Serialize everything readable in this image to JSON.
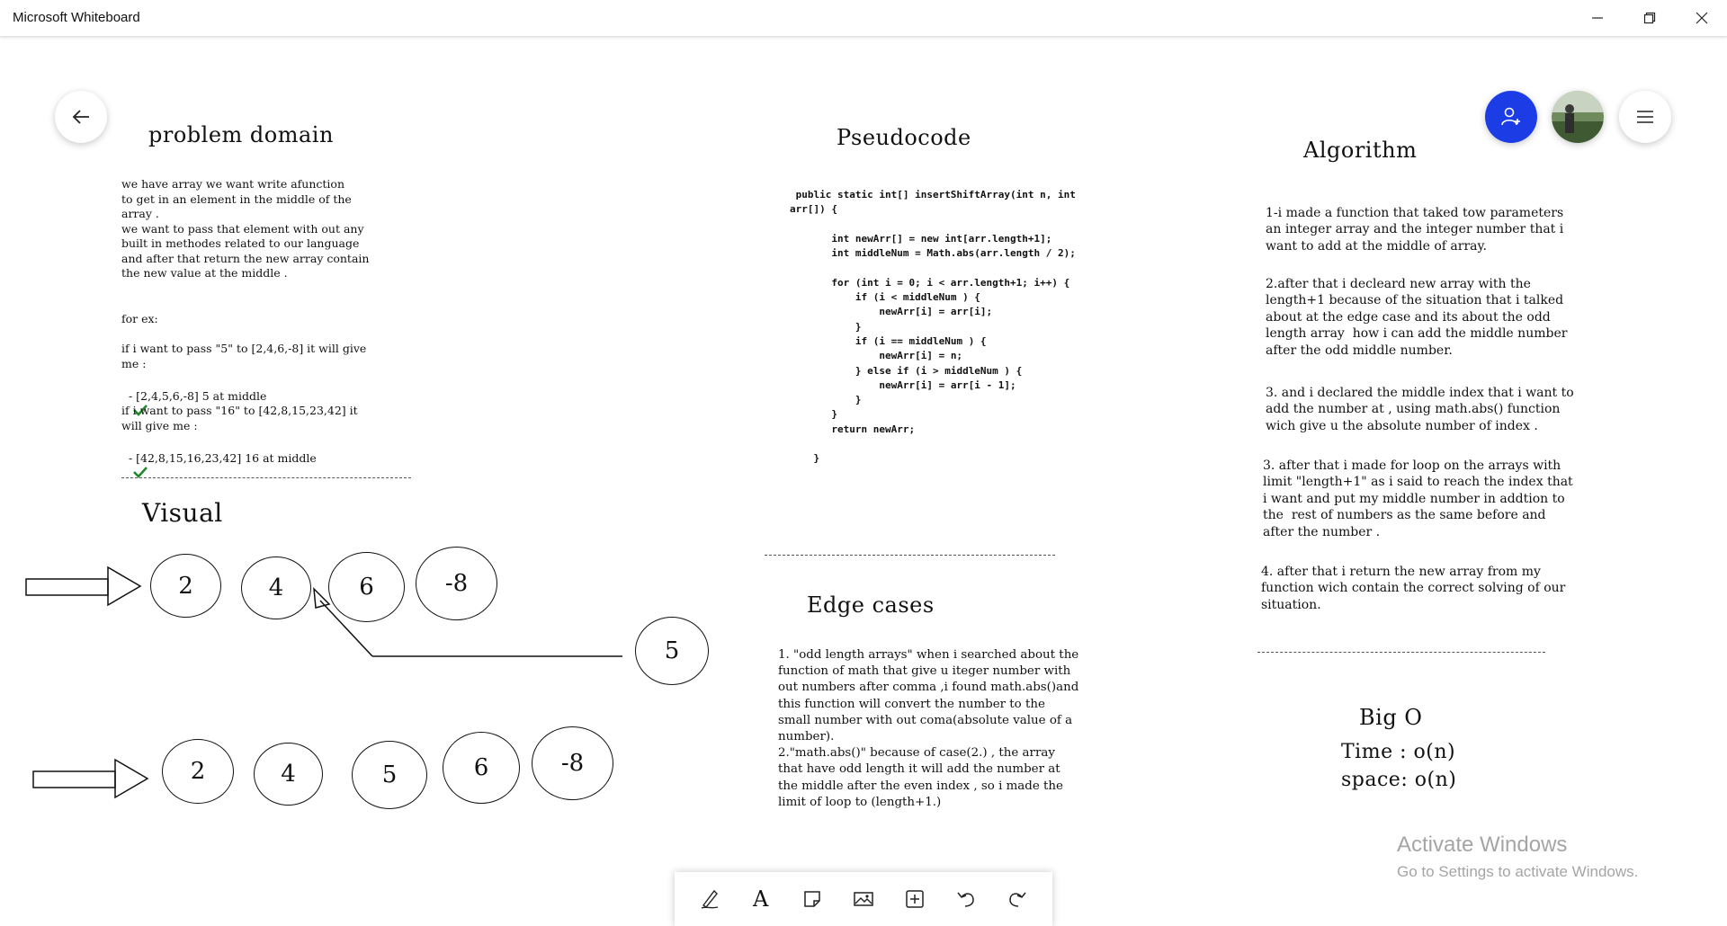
{
  "window": {
    "title": "Microsoft Whiteboard",
    "controls": [
      "minimize-icon",
      "restore-icon",
      "close-icon"
    ]
  },
  "top_controls": {
    "back": "arrow-left-icon",
    "invite": "add-person-icon",
    "avatar": "user-avatar",
    "menu": "hamburger-menu-icon"
  },
  "colors": {
    "invite_blue": "#1c3de6",
    "check_green": "#1f8a2a",
    "watermark": "#a5a5a5"
  },
  "problem_domain": {
    "heading": "problem domain",
    "description": "we have array we want write afunction\nto get in an element in the middle of the\narray .\nwe want to pass that element with out any\nbuilt in methodes related to our language\nand after that return the new array contain\nthe new value at the middle .",
    "for_ex": "for ex:",
    "example1_line": "if i want to pass \"5\" to [2,4,6,-8] it will give\nme :",
    "example1_result": "- [2,4,5,6,-8] 5 at middle",
    "example2_line": "if i want to pass \"16\" to [42,8,15,23,42] it\nwill give me :",
    "example2_result": "- [42,8,15,16,23,42] 16 at middle"
  },
  "pseudocode": {
    "heading": "Pseudocode",
    "code": " public static int[] insertShiftArray(int n, int\narr[]) {\n\n       int newArr[] = new int[arr.length+1];\n       int middleNum = Math.abs(arr.length / 2);\n\n       for (int i = 0; i < arr.length+1; i++) {\n           if (i < middleNum ) {\n               newArr[i] = arr[i];\n           }\n           if (i == middleNum ) {\n               newArr[i] = n;\n           } else if (i > middleNum ) {\n               newArr[i] = arr[i - 1];\n           }\n       }\n       return newArr;\n\n    }"
  },
  "algorithm": {
    "heading": "Algorithm",
    "steps": [
      "1-i made a function that taked tow parameters\nan integer array and the integer number that i\nwant to add at the middle of array.",
      "2.after that i decleard new array with the\nlength+1 because of the situation that i talked\nabout at the edge case and its about the odd\nlength array  how i can add the middle number\nafter the odd middle number.",
      "3. and i declared the middle index that i want to\nadd the number at , using math.abs() function\nwich give u the absolute number of index .",
      "3. after that i made for loop on the arrays with\nlimit \"length+1\" as i said to reach the index that\ni want and put my middle number in addtion to\nthe  rest of numbers as the same before and\nafter the number .",
      "4. after that i return the new array from my\nfunction wich contain the correct solving of our\nsituation."
    ]
  },
  "visual": {
    "heading": "Visual",
    "input_array": [
      "2",
      "4",
      "6",
      "-8"
    ],
    "insert_value": "5",
    "output_array": [
      "2",
      "4",
      "5",
      "6",
      "-8"
    ]
  },
  "edge_cases": {
    "heading": "Edge cases",
    "text": "1. \"odd length arrays\" when i searched about the\nfunction of math that give u iteger number with\nout numbers after comma ,i found math.abs()and\nthis function will convert the number to the\nsmall number with out coma(absolute value of a\nnumber).\n2.\"math.abs()\" because of case(2.) , the array\nthat have odd length it will add the number at\nthe middle after the even index , so i made the\nlimit of loop to (length+1.)"
  },
  "big_o": {
    "heading": "Big O",
    "time": "Time : o(n)",
    "space": "space: o(n)"
  },
  "watermark": {
    "line1": "Activate Windows",
    "line2": "Go to Settings to activate Windows."
  },
  "toolbar": {
    "tools": [
      "pen-icon",
      "text-icon",
      "sticky-note-icon",
      "image-icon",
      "add-icon",
      "undo-icon",
      "redo-icon"
    ],
    "text_glyph": "A"
  }
}
